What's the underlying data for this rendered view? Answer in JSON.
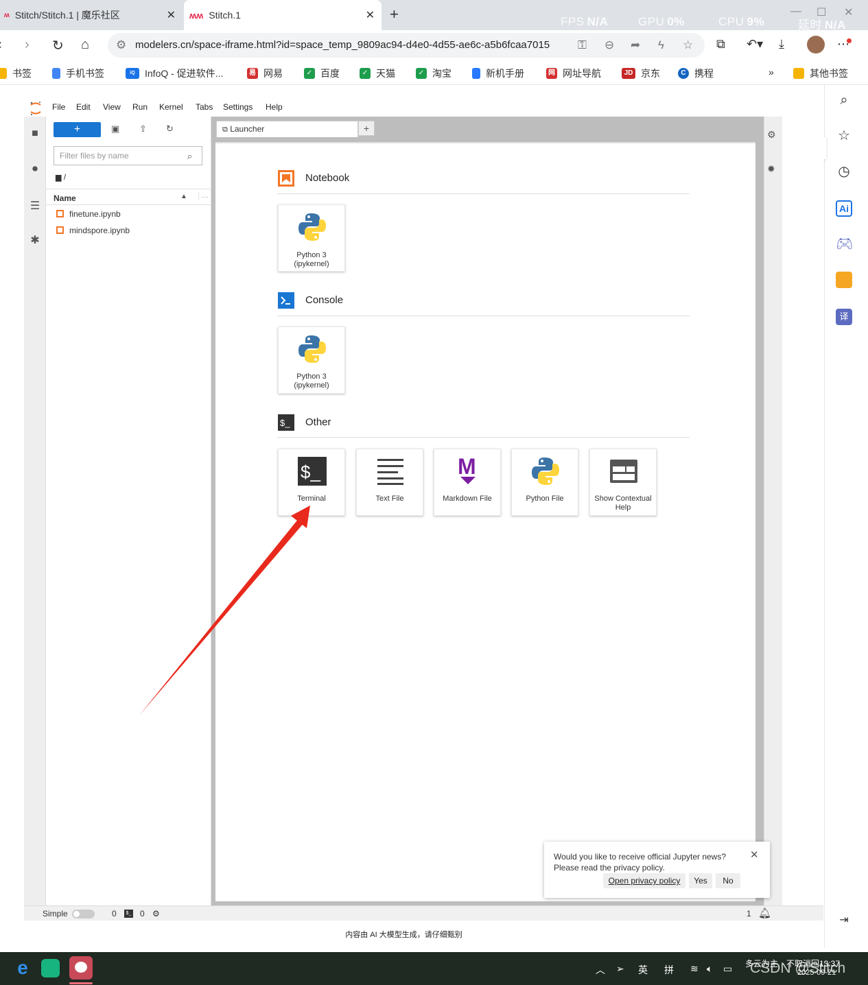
{
  "browser": {
    "tabs": [
      {
        "title": "Stitch/Stitch.1 | 魔乐社区",
        "close": "✕"
      },
      {
        "title": "Stitch.1",
        "close": "✕"
      }
    ],
    "new_tab": "+",
    "perf": {
      "fps_label": "FPS",
      "fps_value": "N/A",
      "gpu_label": "GPU",
      "gpu_value": "0%",
      "cpu_label": "CPU",
      "cpu_value": "9%",
      "latency_label": "延时",
      "latency_value": "N/A"
    },
    "url": "modelers.cn/space-iframe.html?id=space_temp_9809ac94-d4e0-4d55-ae6c-a5b6fcaa7015",
    "bookmarks": [
      {
        "label": "书签"
      },
      {
        "label": "手机书签"
      },
      {
        "label": "InfoQ - 促进软件..."
      },
      {
        "label": "网易"
      },
      {
        "label": "百度"
      },
      {
        "label": "天猫"
      },
      {
        "label": "淘宝"
      },
      {
        "label": "新机手册"
      },
      {
        "label": "网址导航"
      },
      {
        "label": "京东"
      },
      {
        "label": "携程"
      }
    ],
    "bookmarks_more": "»",
    "other_bookmarks": "其他书签"
  },
  "jupyter": {
    "menu": [
      "File",
      "Edit",
      "View",
      "Run",
      "Kernel",
      "Tabs",
      "Settings",
      "Help"
    ],
    "new_button": "+",
    "filter_placeholder": "Filter files by name",
    "breadcrumb": "/",
    "column_name": "Name",
    "files": [
      "finetune.ipynb",
      "mindspore.ipynb"
    ],
    "tab_title": "Launcher",
    "sections": {
      "notebook": {
        "title": "Notebook",
        "cards": [
          {
            "label": "Python 3 (ipykernel)"
          }
        ]
      },
      "console": {
        "title": "Console",
        "cards": [
          {
            "label": "Python 3 (ipykernel)"
          }
        ]
      },
      "other": {
        "title": "Other",
        "cards": [
          {
            "label": "Terminal"
          },
          {
            "label": "Text File"
          },
          {
            "label": "Markdown File"
          },
          {
            "label": "Python File"
          },
          {
            "label": "Show Contextual Help"
          }
        ]
      }
    },
    "status": {
      "mode_label": "Simple",
      "terminals": "0",
      "kernels": "0",
      "notifications": "1"
    },
    "notification": {
      "message": "Would you like to receive official Jupyter news? Please read the privacy policy.",
      "link": "Open privacy policy",
      "yes": "Yes",
      "no": "No"
    }
  },
  "disclaimer": "内容由 AI 大模型生成，请仔细甄别",
  "taskbar": {
    "ime_lang": "英",
    "ime_mode": "拼",
    "weather": "多云为主",
    "datetime": "2025-09-21",
    "time_partial": "不取消回13:37",
    "watermark": "CSDN @Stitch"
  },
  "colors": {
    "accent": "#1976d2",
    "jupyter_orange": "#f37626",
    "arrow": "#e8291c"
  }
}
